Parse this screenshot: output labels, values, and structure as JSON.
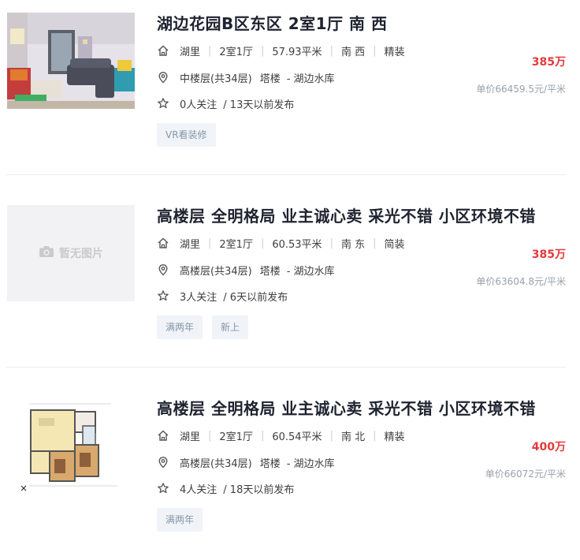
{
  "listings": [
    {
      "title": "湖边花园B区东区 2室1厅 南 西",
      "community": "湖里",
      "layout": "2室1厅",
      "area": "57.93平米",
      "orientation": "南 西",
      "decoration": "精装",
      "floor": "中楼层(共34层)",
      "building": "塔楼",
      "location": "- 湖边水库",
      "followers": "0人关注",
      "published": "/ 13天以前发布",
      "price": "385万",
      "unit_price": "单价66459.5元/平米",
      "tags": [
        "VR看装修"
      ],
      "image": "living-room-photo"
    },
    {
      "title": "高楼层 全明格局 业主诚心卖 采光不错 小区环境不错",
      "community": "湖里",
      "layout": "2室1厅",
      "area": "60.53平米",
      "orientation": "南 东",
      "decoration": "简装",
      "floor": "高楼层(共34层)",
      "building": "塔楼",
      "location": "- 湖边水库",
      "followers": "3人关注",
      "published": "/ 6天以前发布",
      "price": "385万",
      "unit_price": "单价63604.8元/平米",
      "tags": [
        "满两年",
        "新上"
      ],
      "image_placeholder": "暂无图片"
    },
    {
      "title": "高楼层 全明格局 业主诚心卖 采光不错 小区环境不错",
      "community": "湖里",
      "layout": "2室1厅",
      "area": "60.54平米",
      "orientation": "南 北",
      "decoration": "精装",
      "floor": "高楼层(共34层)",
      "building": "塔楼",
      "location": "- 湖边水库",
      "followers": "4人关注",
      "published": "/ 18天以前发布",
      "price": "400万",
      "unit_price": "单价66072元/平米",
      "tags": [
        "满两年"
      ],
      "image": "floor-plan"
    }
  ],
  "icons": {
    "house": "house-icon",
    "location": "location-pin-icon",
    "star": "star-icon",
    "camera": "camera-icon"
  },
  "colors": {
    "title": "#1f2330",
    "price": "#e4393c",
    "tag_bg": "#f0f4f8",
    "tag_text": "#8796a8"
  }
}
